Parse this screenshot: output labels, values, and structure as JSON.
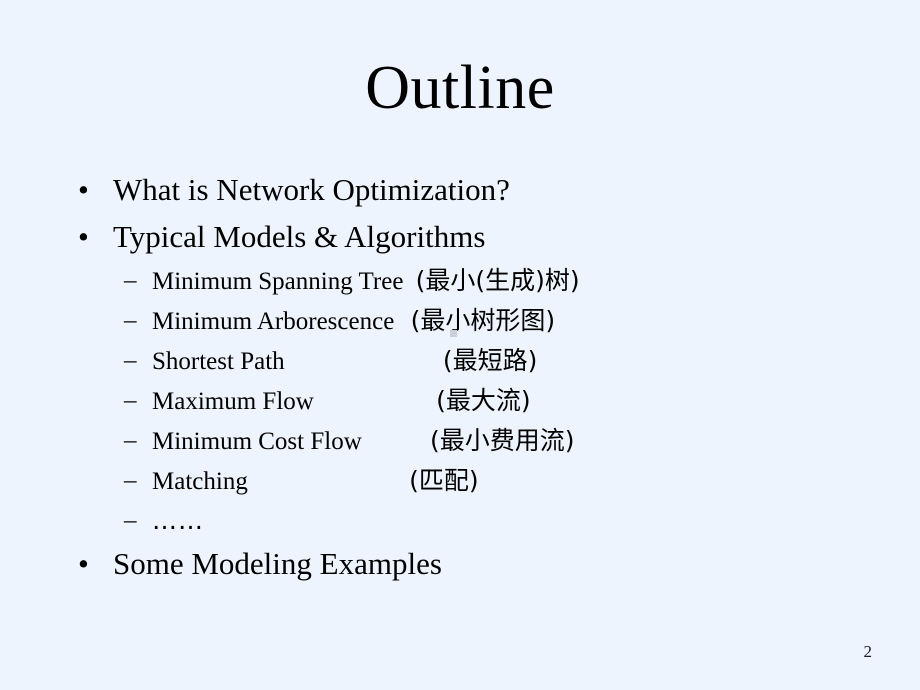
{
  "slide": {
    "title": "Outline",
    "page_number": "2",
    "background_color": "#eef4fd",
    "text_color": "#000000"
  },
  "bullets": [
    {
      "level": 1,
      "marker": "•",
      "text": "What is Network Optimization?"
    },
    {
      "level": 1,
      "marker": "•",
      "text": "Typical Models & Algorithms"
    },
    {
      "level": 2,
      "marker": "–",
      "english": "Minimum Spanning Tree",
      "chinese": "(最小(生成)树)"
    },
    {
      "level": 2,
      "marker": "–",
      "english": "Minimum Arborescence",
      "chinese": "(最小树形图)"
    },
    {
      "level": 2,
      "marker": "–",
      "english": "Shortest Path",
      "chinese": "(最短路)"
    },
    {
      "level": 2,
      "marker": "–",
      "english": "Maximum Flow",
      "chinese": "(最大流)"
    },
    {
      "level": 2,
      "marker": "–",
      "english": "Minimum Cost Flow",
      "chinese": "(最小费用流)"
    },
    {
      "level": 2,
      "marker": "–",
      "english": "Matching",
      "chinese": "(匹配)"
    },
    {
      "level": 2,
      "marker": "–",
      "english": "……",
      "chinese": ""
    },
    {
      "level": 1,
      "marker": "•",
      "text": "Some Modeling Examples"
    }
  ]
}
